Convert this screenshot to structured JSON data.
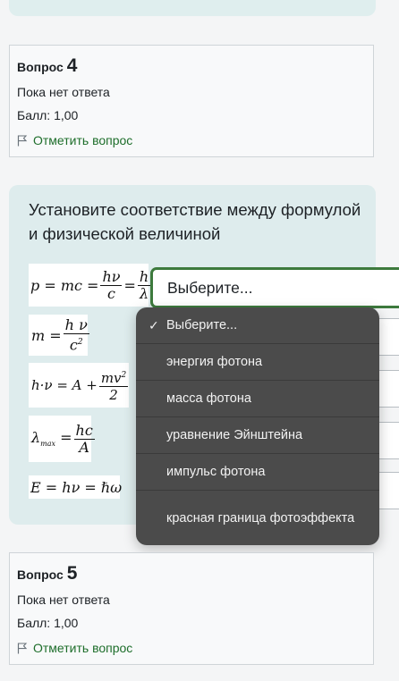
{
  "question4": {
    "label": "Вопрос",
    "number": "4",
    "status": "Пока нет ответа",
    "score": "Балл: 1,00",
    "flag_label": "Отметить вопрос"
  },
  "question_text": "Установите соответствие между формулой и физической величиной",
  "select": {
    "current": "Выберите...",
    "options": [
      {
        "label": "Выберите...",
        "selected": true
      },
      {
        "label": "энергия фотона"
      },
      {
        "label": "масса фотона"
      },
      {
        "label": "уравнение Эйнштейна"
      },
      {
        "label": "импульс фотона"
      },
      {
        "label": "красная граница фотоэффекта"
      }
    ]
  },
  "question5": {
    "label": "Вопрос",
    "number": "5",
    "status": "Пока нет ответа",
    "score": "Балл: 1,00",
    "flag_label": "Отметить вопрос"
  },
  "colors": {
    "accent_green": "#3d7a3d",
    "flag_text": "#1e6e2b",
    "content_bg": "#deeced",
    "dropdown_bg": "#4b4b4b"
  },
  "icons": {
    "flag": "flag-icon",
    "check": "checkmark-icon"
  }
}
